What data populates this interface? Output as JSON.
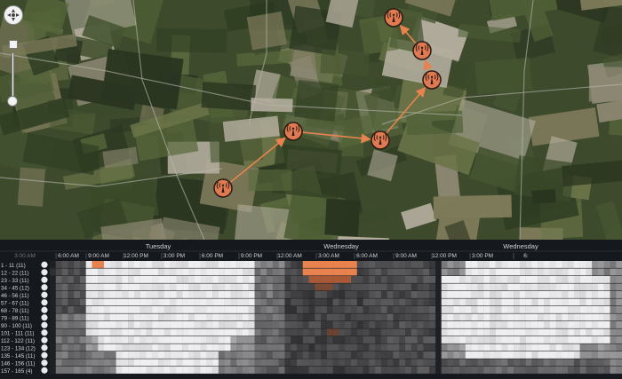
{
  "map": {
    "controls": {
      "pan_icon": "pan-compass-icon",
      "zoom": "zoom-slider"
    },
    "nodes": [
      {
        "id": "n1",
        "icon": "cell-tower-icon"
      },
      {
        "id": "n2",
        "icon": "cell-tower-icon"
      },
      {
        "id": "n3",
        "icon": "cell-tower-icon"
      },
      {
        "id": "n4",
        "icon": "cell-tower-icon"
      },
      {
        "id": "n5",
        "icon": "cell-tower-icon"
      },
      {
        "id": "n6",
        "icon": "cell-tower-icon"
      }
    ],
    "links": [
      [
        "n1",
        "n2"
      ],
      [
        "n2",
        "n3"
      ],
      [
        "n3",
        "n4"
      ],
      [
        "n4",
        "n5"
      ],
      [
        "n5",
        "n6"
      ]
    ],
    "colors": {
      "node": "#e07a52",
      "link": "#e8834f"
    }
  },
  "timeline": {
    "days": [
      "Tuesday",
      "Wednesday",
      "Wednesday"
    ],
    "clipped_time": "3:00 AM",
    "times": [
      "6:00 AM",
      "9:00 AM",
      "12:00 PM",
      "3:00 PM",
      "6:00 PM",
      "9:00 PM",
      "12:00 AM",
      "3:00 AM",
      "6:00 AM",
      "9:00 AM",
      "12:00 PM",
      "3:00 PM",
      "6:"
    ],
    "rows": [
      "1 - 11 (11)",
      "12 - 22 (11)",
      "23 - 33 (11)",
      "34 - 45 (12)",
      "46 - 56 (11)",
      "57 - 67 (11)",
      "68 - 78 (11)",
      "79 - 89 (11)",
      "90 - 100 (11)",
      "101 - 111 (11)",
      "112 - 122 (11)",
      "123 - 134 (12)",
      "135 - 145 (11)",
      "146 - 156 (11)",
      "157 - 165 (4)"
    ],
    "colors": {
      "high": "#efefef",
      "accent": "#e8834f",
      "background": "#15181c"
    }
  }
}
